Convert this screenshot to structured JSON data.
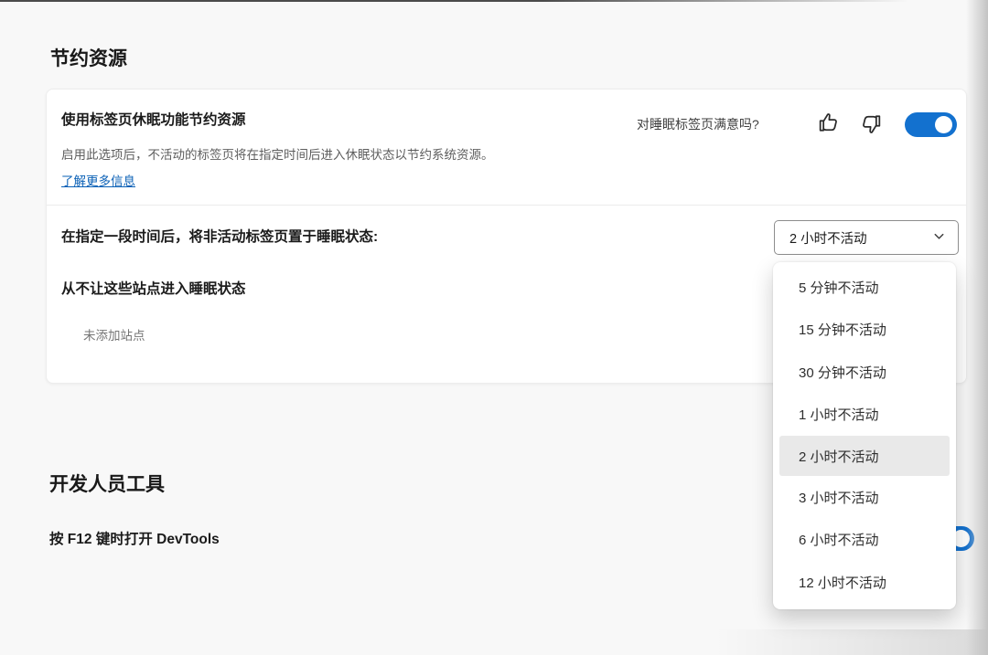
{
  "page": {
    "background": "#f8f8f8",
    "accent_blue": "#1371cf",
    "link_color": "#0a60b6",
    "option_highlight": "#e9e9e9"
  },
  "resources_section": {
    "title": "节约资源",
    "sleeping_tabs": {
      "title": "使用标签页休眠功能节约资源",
      "description": "启用此选项后，不活动的标签页将在指定时间后进入休眠状态以节约系统资源。",
      "learn_more_label": "了解更多信息",
      "feedback_prompt": "对睡眠标签页满意吗?",
      "toggle_state": "on"
    },
    "timeout_row": {
      "label": "在指定一段时间后，将非活动标签页置于睡眠状态:",
      "selected_value": "2 小时不活动"
    },
    "never_sleep": {
      "title": "从不让这些站点进入睡眠状态",
      "empty_text": "未添加站点"
    }
  },
  "timeout_dropdown": {
    "options": [
      "5 分钟不活动",
      "15 分钟不活动",
      "30 分钟不活动",
      "1 小时不活动",
      "2 小时不活动",
      "3 小时不活动",
      "6 小时不活动",
      "12 小时不活动"
    ],
    "selected_index": 4
  },
  "devtools_section": {
    "title": "开发人员工具",
    "f12_label": "按 F12 键时打开 DevTools",
    "toggle_state": "on"
  },
  "icons": {
    "thumbs_up": "thumbs-up-icon",
    "thumbs_down": "thumbs-down-icon",
    "chevron_down": "chevron-down-icon"
  }
}
